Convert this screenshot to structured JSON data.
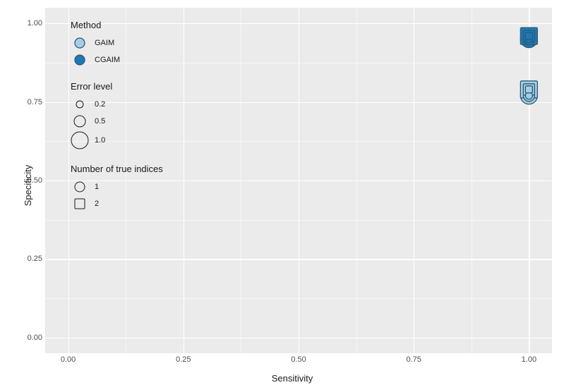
{
  "chart_data": {
    "type": "scatter",
    "title": "",
    "xlabel": "Sensitivity",
    "ylabel": "Specificity",
    "xlim": [
      -0.05,
      1.05
    ],
    "ylim": [
      -0.05,
      1.05
    ],
    "x_ticks": [
      0.0,
      0.25,
      0.5,
      0.75,
      1.0
    ],
    "y_ticks": [
      0.0,
      0.25,
      0.5,
      0.75,
      1.0
    ],
    "legends": {
      "method": {
        "title": "Method",
        "items": [
          {
            "label": "GAIM",
            "fill": "#a6cee3"
          },
          {
            "label": "CGAIM",
            "fill": "#1f78b4"
          }
        ]
      },
      "error_level": {
        "title": "Error level",
        "items": [
          {
            "label": "0.2",
            "size": 10
          },
          {
            "label": "0.5",
            "size": 16
          },
          {
            "label": "1.0",
            "size": 24
          }
        ]
      },
      "num_true_indices": {
        "title": "Number of true indices",
        "items": [
          {
            "label": "1",
            "shape": "circle"
          },
          {
            "label": "2",
            "shape": "square"
          }
        ]
      }
    },
    "series": [
      {
        "method": "GAIM",
        "n_indices": 1,
        "error": 0.2,
        "x": 1.0,
        "y": 0.77
      },
      {
        "method": "GAIM",
        "n_indices": 1,
        "error": 0.5,
        "x": 1.0,
        "y": 0.77
      },
      {
        "method": "GAIM",
        "n_indices": 1,
        "error": 1.0,
        "x": 1.0,
        "y": 0.77
      },
      {
        "method": "GAIM",
        "n_indices": 2,
        "error": 0.2,
        "x": 1.0,
        "y": 0.79
      },
      {
        "method": "GAIM",
        "n_indices": 2,
        "error": 0.5,
        "x": 1.0,
        "y": 0.79
      },
      {
        "method": "GAIM",
        "n_indices": 2,
        "error": 1.0,
        "x": 1.0,
        "y": 0.79
      },
      {
        "method": "CGAIM",
        "n_indices": 1,
        "error": 0.2,
        "x": 1.0,
        "y": 0.95
      },
      {
        "method": "CGAIM",
        "n_indices": 1,
        "error": 0.5,
        "x": 1.0,
        "y": 0.95
      },
      {
        "method": "CGAIM",
        "n_indices": 1,
        "error": 1.0,
        "x": 1.0,
        "y": 0.95
      },
      {
        "method": "CGAIM",
        "n_indices": 2,
        "error": 0.2,
        "x": 1.0,
        "y": 0.96
      },
      {
        "method": "CGAIM",
        "n_indices": 2,
        "error": 0.5,
        "x": 1.0,
        "y": 0.96
      },
      {
        "method": "CGAIM",
        "n_indices": 2,
        "error": 1.0,
        "x": 1.0,
        "y": 0.96
      }
    ],
    "colors": {
      "GAIM": "#a6cee3",
      "CGAIM": "#1f78b4"
    },
    "sizes": {
      "0.2": 10,
      "0.5": 16,
      "1.0": 24
    },
    "shapes": {
      "1": "circle",
      "2": "square"
    }
  }
}
